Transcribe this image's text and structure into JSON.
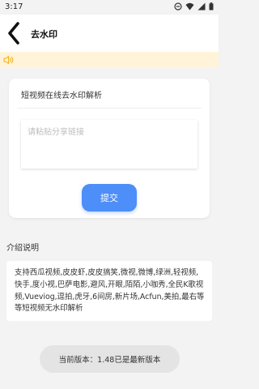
{
  "status_bar": {
    "time": "3:17",
    "icons": [
      "do-not-disturb-icon",
      "wifi-icon",
      "signal-icon",
      "battery-icon"
    ]
  },
  "app_bar": {
    "back_icon": "chevron-left-icon",
    "title": "去水印"
  },
  "notice": {
    "icon": "speaker-icon",
    "text": ""
  },
  "parser_card": {
    "title": "短视频在线去水印解析",
    "input_value": "",
    "input_placeholder": "请粘贴分享链接",
    "submit_label": "提交"
  },
  "intro": {
    "heading": "介绍说明",
    "text": "支持西瓜视频,皮皮虾,皮皮搞笑,微视,微博,绿洲,轻视频,快手,度小视,巴萨电影,避风,开眼,陌陌,小咖秀,全民K歌视频,Vueviog,逗拍,虎牙,6间房,新片场,Acfun,美拍,最右等等短视频无水印解析"
  },
  "version": {
    "text": "当前版本：1.48已是最新版本"
  },
  "colors": {
    "accent": "#4d8ef8",
    "notice_bg": "#fff3d9",
    "notice_icon": "#f2b21e",
    "page_bg": "#f3f3f3"
  }
}
